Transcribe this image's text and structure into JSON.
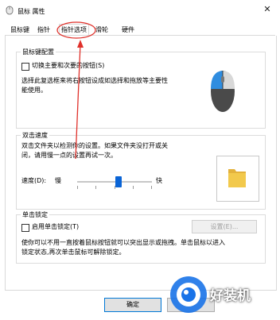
{
  "window": {
    "title": "鼠标 属性",
    "close_glyph": "✕"
  },
  "tabs": [
    {
      "label": "鼠标键",
      "active": false
    },
    {
      "label": "指针",
      "active": false
    },
    {
      "label": "指针选项",
      "active": true
    },
    {
      "label": "滑轮",
      "active": false
    },
    {
      "label": "硬件",
      "active": false
    }
  ],
  "button_config": {
    "heading": "鼠标键配置",
    "switch_checkbox_label": "切换主要和次要的按钮(S)",
    "switch_checked": false,
    "description_line1": "选择此复选框来将右按钮设成如选择和拖放等主要性",
    "description_line2": "能使用。"
  },
  "double_click": {
    "heading": "双击速度",
    "description_line1": "双击文件夹以检测你的设置。如果文件夹没打开或关",
    "description_line2": "闭，请用慢一点的设置再试一次。",
    "speed_label": "速度(D):",
    "slow_label": "慢",
    "fast_label": "快",
    "speed_level": 0.55
  },
  "click_lock": {
    "heading": "单击锁定",
    "enable_label": "启用单击锁定(T)",
    "enabled": false,
    "settings_button": "设置(E)...",
    "description_line1": "使你可以不用一直按着鼠标按钮就可以突出显示或拖拽。单击鼠标以进入",
    "description_line2": "锁定状态,再次单击鼠标可解除锁定。"
  },
  "footer": {
    "ok_button": "确定"
  },
  "watermark": {
    "text": "好装机"
  },
  "colors": {
    "annotation_red": "#e0302a",
    "accent_blue": "#0a64d6",
    "folder_yellow": "#f2c94c"
  }
}
